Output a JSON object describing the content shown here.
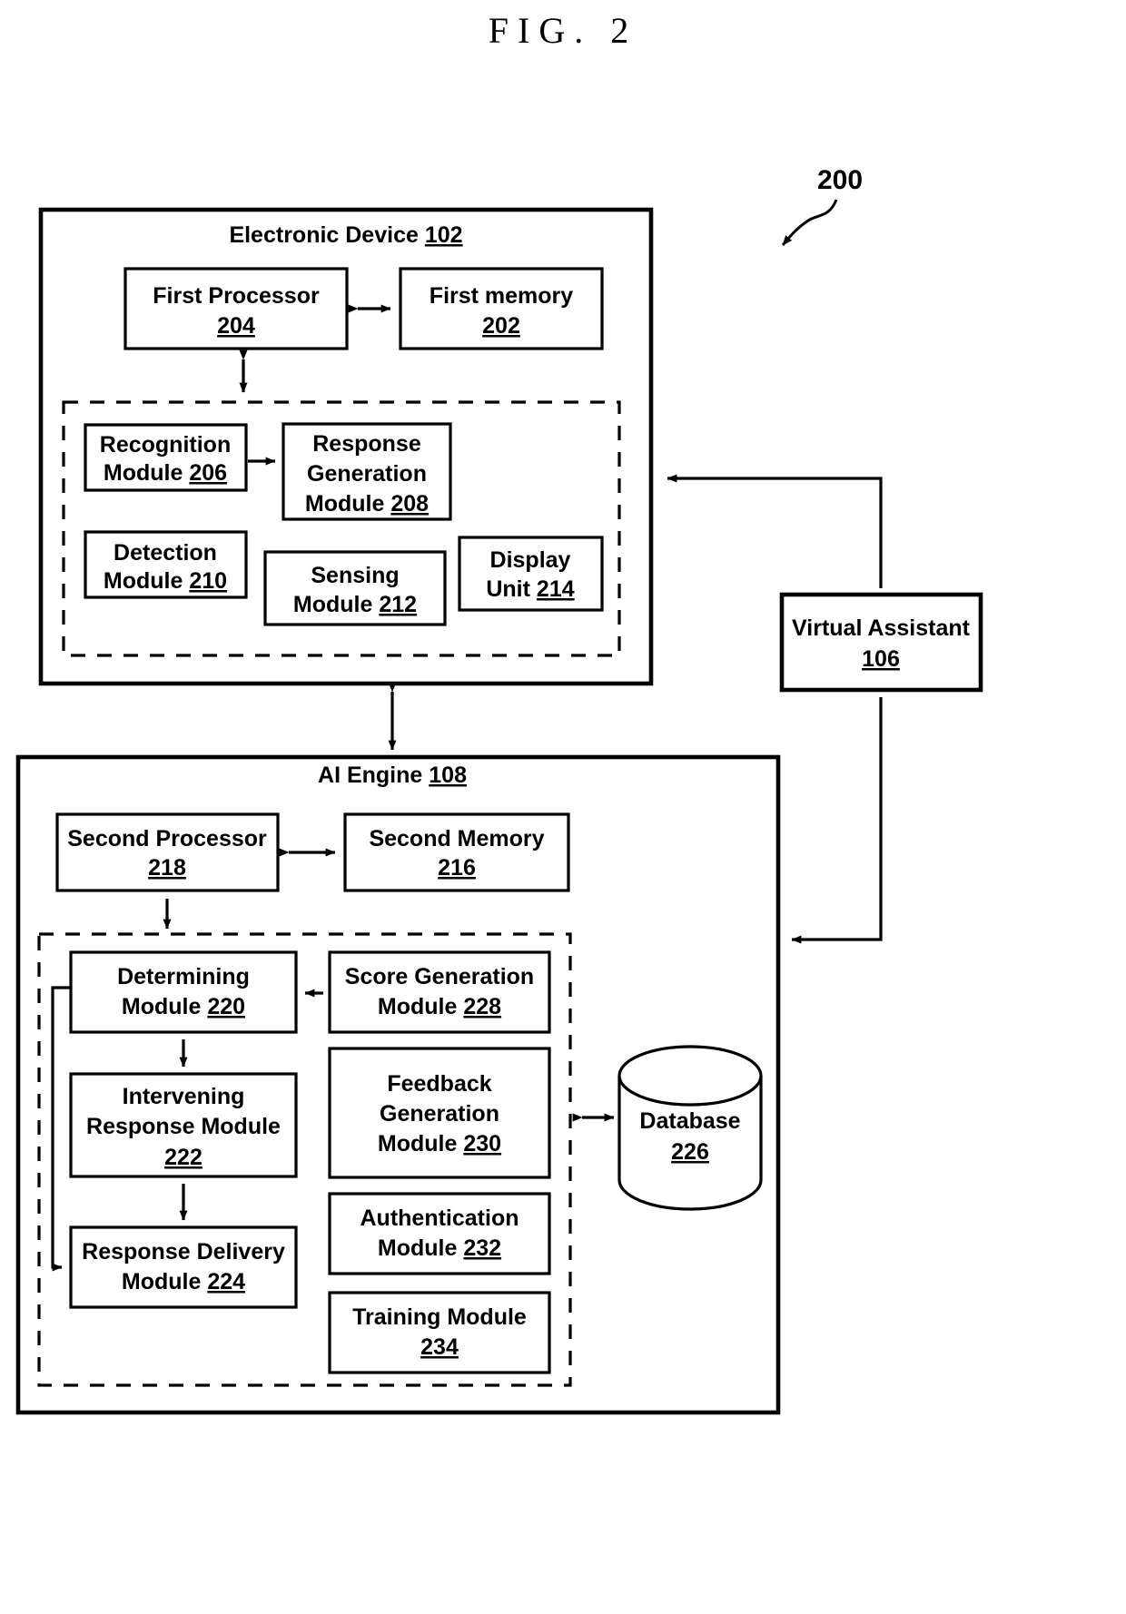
{
  "figure": {
    "title": "FIG. 2",
    "system_ref": "200"
  },
  "electronic_device": {
    "title": "Electronic Device",
    "ref": "102",
    "top_boxes": [
      {
        "name": "first-processor",
        "line1": "First Processor",
        "ref": "204"
      },
      {
        "name": "first-memory",
        "line1": "First memory",
        "ref": "202"
      }
    ],
    "modules": [
      {
        "name": "recognition-module",
        "line1": "Recognition",
        "line2": "Module",
        "ref": "206"
      },
      {
        "name": "response-generation-module",
        "line1": "Response",
        "line2": "Generation",
        "line3": "Module",
        "ref": "208"
      },
      {
        "name": "detection-module",
        "line1": "Detection",
        "line2": "Module",
        "ref": "210"
      },
      {
        "name": "sensing-module",
        "line1": "Sensing",
        "line2": "Module",
        "ref": "212"
      },
      {
        "name": "display-unit",
        "line1": "Display",
        "line2": "Unit",
        "ref": "214"
      }
    ]
  },
  "virtual_assistant": {
    "title": "Virtual Assistant",
    "ref": "106"
  },
  "ai_engine": {
    "title": "AI Engine",
    "ref": "108",
    "top_boxes": [
      {
        "name": "second-processor",
        "line1": "Second Processor",
        "ref": "218"
      },
      {
        "name": "second-memory",
        "line1": "Second Memory",
        "ref": "216"
      }
    ],
    "left_modules": [
      {
        "name": "determining-module",
        "line1": "Determining",
        "line2": "Module",
        "ref": "220"
      },
      {
        "name": "intervening-response-module",
        "line1": "Intervening",
        "line2": "Response Module",
        "ref": "222"
      },
      {
        "name": "response-delivery-module",
        "line1": "Response Delivery",
        "line2": "Module",
        "ref": "224"
      }
    ],
    "right_modules": [
      {
        "name": "score-generation-module",
        "line1": "Score Generation",
        "line2": "Module",
        "ref": "228"
      },
      {
        "name": "feedback-generation-module",
        "line1": "Feedback",
        "line2": "Generation",
        "line3": "Module",
        "ref": "230"
      },
      {
        "name": "authentication-module",
        "line1": "Authentication",
        "line2": "Module",
        "ref": "232"
      },
      {
        "name": "training-module",
        "line1": "Training Module",
        "ref": "234"
      }
    ]
  },
  "database": {
    "title": "Database",
    "ref": "226"
  },
  "colors": {
    "ink": "#000000",
    "paper": "#ffffff"
  }
}
